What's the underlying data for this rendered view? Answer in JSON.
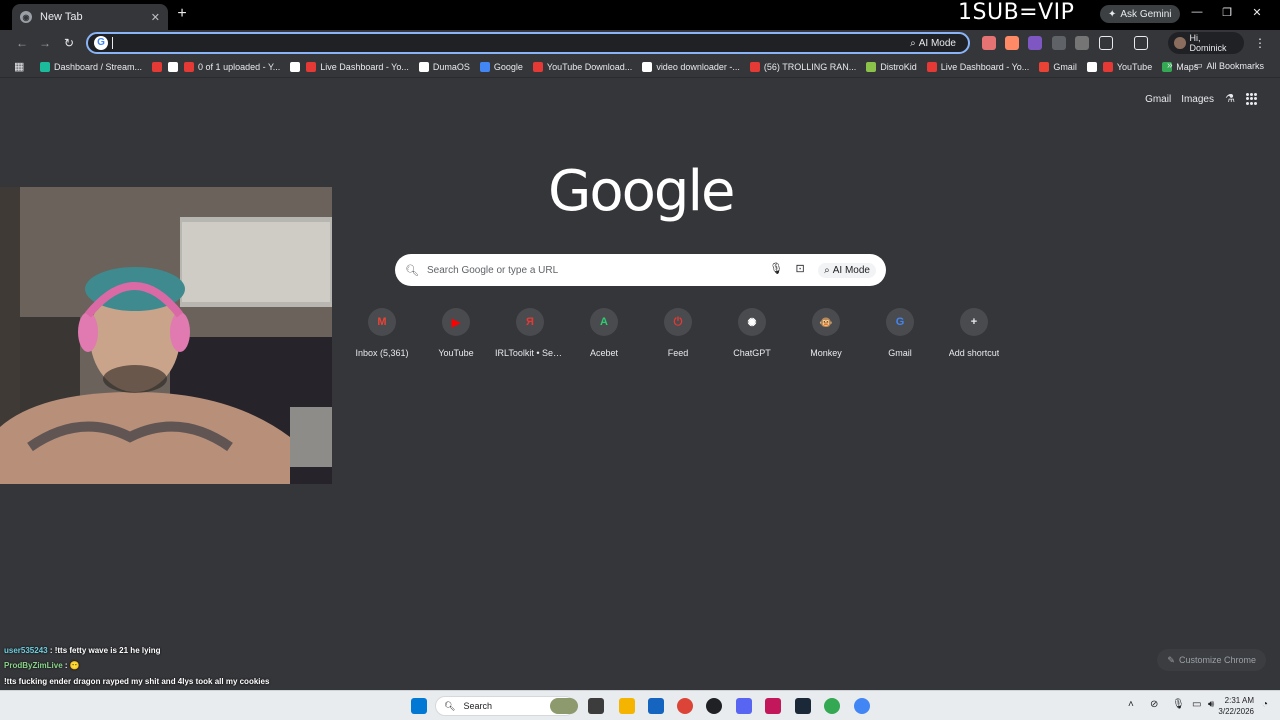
{
  "tab": {
    "title": "New Tab"
  },
  "overlay": {
    "sub_text": "1SUB=VIP",
    "gemini": "Ask Gemini"
  },
  "omnibox": {
    "ai_mode": "AI Mode"
  },
  "profile": {
    "greeting": "Hi, Dominick"
  },
  "bookmarks": [
    {
      "label": "Dashboard / Stream...",
      "color": "#1abc9c"
    },
    {
      "label": "",
      "color": "#e53935"
    },
    {
      "label": "",
      "color": "#ffffff"
    },
    {
      "label": "0 of 1 uploaded - Y...",
      "color": "#e53935"
    },
    {
      "label": "",
      "color": "#ffffff"
    },
    {
      "label": "Live Dashboard - Yo...",
      "color": "#e53935"
    },
    {
      "label": "DumaOS",
      "color": "#ffffff"
    },
    {
      "label": "Google",
      "color": "#4285f4"
    },
    {
      "label": "YouTube Download...",
      "color": "#e53935"
    },
    {
      "label": "video downloader -...",
      "color": "#ffffff"
    },
    {
      "label": "(56) TROLLING RAN...",
      "color": "#e53935"
    },
    {
      "label": "DistroKid",
      "color": "#8bc34a"
    },
    {
      "label": "Live Dashboard - Yo...",
      "color": "#e53935"
    },
    {
      "label": "Gmail",
      "color": "#ea4335"
    },
    {
      "label": "",
      "color": "#ffffff"
    },
    {
      "label": "YouTube",
      "color": "#e53935"
    },
    {
      "label": "Maps",
      "color": "#34a853"
    }
  ],
  "all_bookmarks": "All Bookmarks",
  "ntp": {
    "gmail": "Gmail",
    "images": "Images",
    "logo": "Google",
    "search_placeholder": "Search Google or type a URL",
    "ai_mode": "AI Mode",
    "customize": "Customize Chrome",
    "shortcuts": [
      {
        "label": "Inbox (5,361)",
        "glyph": "M",
        "color": "#ea4335"
      },
      {
        "label": "YouTube",
        "glyph": "▶",
        "color": "#ff0000"
      },
      {
        "label": "IRLToolkit • Serv...",
        "glyph": "Я",
        "color": "#e53935"
      },
      {
        "label": "Acebet",
        "glyph": "A",
        "color": "#2ecc71"
      },
      {
        "label": "Feed",
        "glyph": "⏻",
        "color": "#e53935"
      },
      {
        "label": "ChatGPT",
        "glyph": "✺",
        "color": "#ffffff"
      },
      {
        "label": "Monkey",
        "glyph": "🐵",
        "color": "#f4b400"
      },
      {
        "label": "Gmail",
        "glyph": "G",
        "color": "#4285f4"
      },
      {
        "label": "Add shortcut",
        "glyph": "+",
        "color": "#e8eaed"
      }
    ]
  },
  "chat": [
    {
      "user": "user535243",
      "text": ": !tts fetty wave is 21 he lying"
    },
    {
      "user": "ProdByZimLive",
      "text": ":"
    },
    {
      "user": "",
      "text": "!tts fucking ender dragon rayped my shit and 4lys took all my cookies"
    }
  ],
  "taskbar": {
    "search": "Search",
    "time": "2:31 AM",
    "date": "3/22/2026"
  }
}
